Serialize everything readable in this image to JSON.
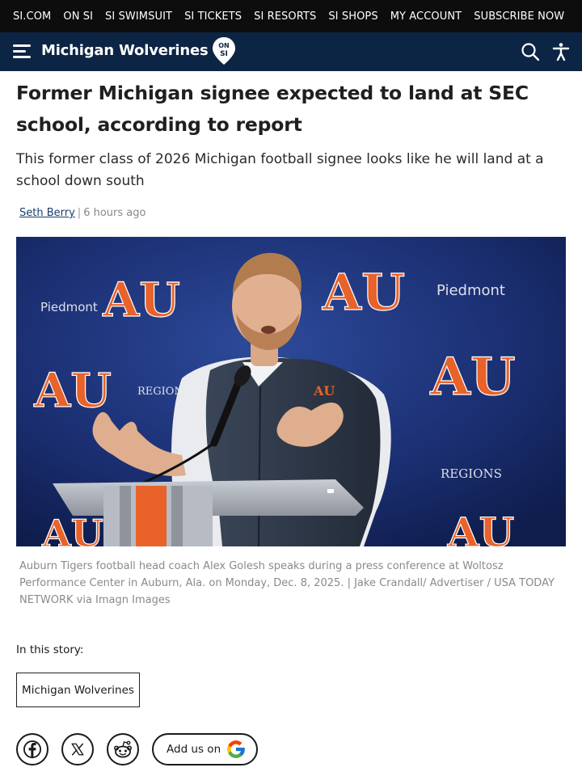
{
  "top_nav": {
    "items": [
      "SI.COM",
      "ON SI",
      "SI SWIMSUIT",
      "SI TICKETS",
      "SI RESORTS",
      "SI SHOPS",
      "MY ACCOUNT",
      "SUBSCRIBE NOW"
    ]
  },
  "header": {
    "site_name": "Michigan Wolverines",
    "badge_text_top": "ON",
    "badge_text_bottom": "SI",
    "menu_icon": "hamburger-icon",
    "search_icon": "search-icon",
    "accessibility_icon": "accessibility-icon",
    "background": "#0c2544"
  },
  "article": {
    "headline": "Former Michigan signee expected to land at SEC school, according to report",
    "dek": "This former class of 2026 Michigan football signee looks like he will land at a school down south",
    "author": "Seth Berry",
    "separator": "|",
    "published": "6 hours ago",
    "image_caption": "Auburn Tigers football head coach Alex Golesh speaks during a press conference at Woltosz Performance Center in Auburn, Ala. on Monday, Dec. 8, 2025. | Jake Crandall/ Advertiser / USA TODAY NETWORK via Imagn Images",
    "backdrop_text": {
      "sponsor_1": "Piedmont",
      "sponsor_2": "REGIONS",
      "logo": "AU"
    }
  },
  "story": {
    "label": "In this story:",
    "tags": [
      "Michigan Wolverines"
    ]
  },
  "share": {
    "icons": [
      "facebook-icon",
      "x-icon",
      "reddit-icon"
    ],
    "add_us_label": "Add us on",
    "google_icon": "google-icon"
  }
}
